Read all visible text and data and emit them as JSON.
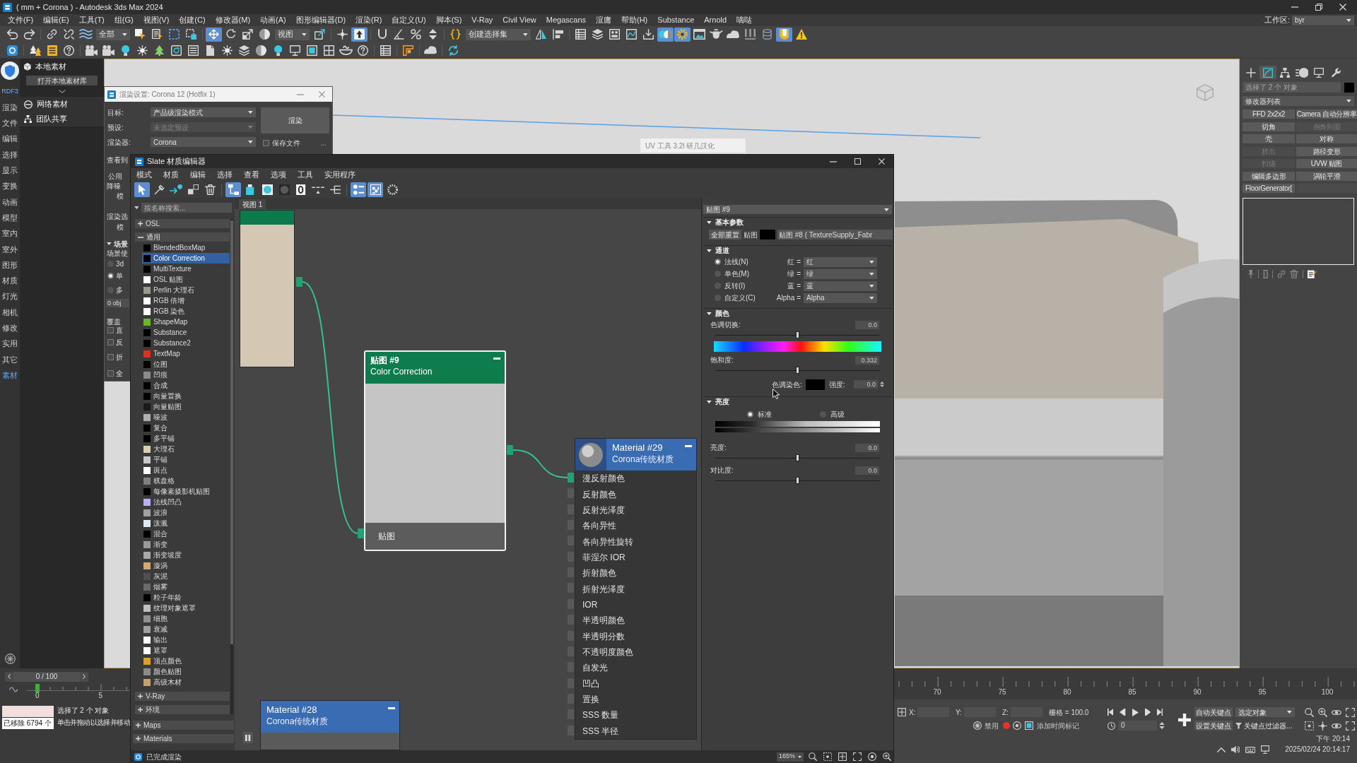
{
  "window": {
    "title": "( mm + Corona ) - Autodesk 3ds Max 2024"
  },
  "menu_bar": {
    "items": [
      "文件(F)",
      "编辑(E)",
      "工具(T)",
      "组(G)",
      "视图(V)",
      "创建(C)",
      "修改器(M)",
      "动画(A)",
      "图形编辑器(D)",
      "渲染(R)",
      "自定义(U)",
      "脚本(S)",
      "V-Ray",
      "Civil View",
      "Megascans",
      "渲庸",
      "帮助(H)",
      "Substance",
      "Arnold",
      "嘀哒"
    ],
    "workspace_label": "工作区:",
    "workspace_value": "byr"
  },
  "main_toolbar": [
    {
      "kind": "button",
      "selected": false
    },
    {
      "kind": "button",
      "selected": false
    },
    {
      "kind": "separator"
    },
    {
      "kind": "button",
      "selected": false
    },
    {
      "kind": "button",
      "selected": false
    },
    {
      "kind": "button",
      "selected": false
    },
    {
      "kind": "dropdown",
      "value": "全部"
    },
    {
      "kind": "button",
      "selected": false
    },
    {
      "kind": "button",
      "selected": false
    },
    {
      "kind": "button",
      "selected": false
    },
    {
      "kind": "button",
      "selected": false
    },
    {
      "kind": "separator"
    },
    {
      "kind": "button",
      "selected": true
    },
    {
      "kind": "button",
      "selected": false
    },
    {
      "kind": "button",
      "selected": false
    },
    {
      "kind": "button",
      "selected": false
    },
    {
      "kind": "dropdown",
      "value": "视图"
    },
    {
      "kind": "button",
      "selected": false
    },
    {
      "kind": "separator"
    },
    {
      "kind": "button",
      "selected": false
    },
    {
      "kind": "button",
      "selected": true
    },
    {
      "kind": "separator"
    },
    {
      "kind": "button",
      "selected": false
    },
    {
      "kind": "button",
      "selected": false
    },
    {
      "kind": "button",
      "selected": false
    },
    {
      "kind": "button",
      "selected": false
    },
    {
      "kind": "separator"
    },
    {
      "kind": "button",
      "selected": false
    },
    {
      "kind": "dropdown",
      "value": "创建选择集"
    },
    {
      "kind": "button",
      "selected": false
    },
    {
      "kind": "button",
      "selected": false
    },
    {
      "kind": "separator"
    },
    {
      "kind": "button",
      "selected": false
    },
    {
      "kind": "button",
      "selected": false
    },
    {
      "kind": "button",
      "selected": false
    },
    {
      "kind": "button",
      "selected": false
    },
    {
      "kind": "button",
      "selected": false
    },
    {
      "kind": "button",
      "selected": true
    },
    {
      "kind": "button",
      "selected": true
    },
    {
      "kind": "button",
      "selected": false
    },
    {
      "kind": "button",
      "selected": false
    },
    {
      "kind": "button",
      "selected": false
    },
    {
      "kind": "button",
      "selected": false
    },
    {
      "kind": "button",
      "selected": false
    },
    {
      "kind": "button",
      "selected": true
    },
    {
      "kind": "button",
      "selected": false
    }
  ],
  "secondary_toolbar": [
    {
      "kind": "button",
      "selected": false
    },
    {
      "kind": "separator"
    },
    {
      "kind": "button",
      "selected": false
    },
    {
      "kind": "button",
      "selected": false
    },
    {
      "kind": "button",
      "selected": false
    },
    {
      "kind": "separator"
    },
    {
      "kind": "button",
      "selected": false
    },
    {
      "kind": "button",
      "selected": false
    },
    {
      "kind": "button",
      "selected": false
    },
    {
      "kind": "button",
      "selected": false
    },
    {
      "kind": "button",
      "selected": false
    },
    {
      "kind": "button",
      "selected": false
    },
    {
      "kind": "button",
      "selected": false
    },
    {
      "kind": "button",
      "selected": false
    },
    {
      "kind": "button",
      "selected": false
    },
    {
      "kind": "button",
      "selected": false
    },
    {
      "kind": "button",
      "selected": false
    },
    {
      "kind": "button",
      "selected": false
    },
    {
      "kind": "button",
      "selected": false
    },
    {
      "kind": "button",
      "selected": false
    },
    {
      "kind": "button",
      "selected": false
    },
    {
      "kind": "button",
      "selected": false
    },
    {
      "kind": "button",
      "selected": false
    },
    {
      "kind": "separator"
    },
    {
      "kind": "button",
      "selected": false
    },
    {
      "kind": "separator"
    },
    {
      "kind": "button",
      "selected": false
    },
    {
      "kind": "separator"
    },
    {
      "kind": "button",
      "selected": false
    },
    {
      "kind": "separator"
    },
    {
      "kind": "button",
      "selected": false
    }
  ],
  "side_tabs": {
    "label": "RDF3",
    "items": [
      {
        "label": "渲染",
        "selected": false
      },
      {
        "label": "文件",
        "selected": false
      },
      {
        "label": "编辑",
        "selected": false
      },
      {
        "label": "选择",
        "selected": false
      },
      {
        "label": "显示",
        "selected": false
      },
      {
        "label": "变换",
        "selected": false
      },
      {
        "label": "动画",
        "selected": false
      },
      {
        "label": "模型",
        "selected": false
      },
      {
        "label": "室内",
        "selected": false
      },
      {
        "label": "室外",
        "selected": false
      },
      {
        "label": "图形",
        "selected": false
      },
      {
        "label": "材质",
        "selected": false
      },
      {
        "label": "灯光",
        "selected": false
      },
      {
        "label": "相机",
        "selected": false
      },
      {
        "label": "修改",
        "selected": false
      },
      {
        "label": "实用",
        "selected": false
      },
      {
        "label": "其它",
        "selected": false
      },
      {
        "label": "素材",
        "selected": true
      }
    ]
  },
  "asset_panel": {
    "local_title": "本地素材",
    "open_button": "打开本地素材库",
    "online_title": "网络素材",
    "team_title": "团队共享"
  },
  "viewport": {
    "tool_window_title": "UV 工具 3.2l 研几汉化"
  },
  "command_panel": {
    "tabs": [
      {
        "selected": false
      },
      {
        "selected": true
      },
      {
        "selected": false
      },
      {
        "selected": false
      },
      {
        "selected": false
      },
      {
        "selected": false
      }
    ],
    "object_name": "选择了 2 个 对象",
    "modifier_list": "修改器列表",
    "modifier_buttons": [
      {
        "kind": "button",
        "label": "FFD 2x2x2",
        "disabled": false
      },
      {
        "kind": "button",
        "label": "Camera 自动分辨率",
        "disabled": false
      },
      {
        "kind": "button",
        "label": "切角",
        "disabled": false
      },
      {
        "kind": "button",
        "label": "倒角剖面",
        "disabled": true
      },
      {
        "kind": "button",
        "label": "壳",
        "disabled": false
      },
      {
        "kind": "button",
        "label": "对称",
        "disabled": false
      },
      {
        "kind": "button",
        "label": "挤出",
        "disabled": true
      },
      {
        "kind": "button",
        "label": "路径变形",
        "disabled": false
      },
      {
        "kind": "button",
        "label": "扫描",
        "disabled": true
      },
      {
        "kind": "button",
        "label": "UVW 贴图",
        "disabled": false
      },
      {
        "kind": "button",
        "label": "编辑多边形",
        "disabled": false
      },
      {
        "kind": "button",
        "label": "涡轮平滑",
        "disabled": false
      },
      {
        "kind": "button",
        "label": "FloorGenerator[",
        "disabled": false
      },
      {
        "kind": "blank"
      }
    ]
  },
  "render_setup": {
    "title": "渲染设置: Corona 12 (Hotfix 1)",
    "fields": [
      {
        "label": "目标:",
        "value": "产品级渲染模式",
        "disabled": false
      },
      {
        "label": "预设:",
        "value": "未选定预设",
        "disabled": true
      },
      {
        "label": "渲染器:",
        "value": "Corona",
        "disabled": false
      }
    ],
    "render_button": "渲染",
    "save_file": {
      "label": "保存文件",
      "checked": false
    },
    "more_button": "...",
    "clipped_rows": [
      {
        "kind": "label",
        "text": "查看到"
      },
      {
        "kind": "tab",
        "text": "公用"
      },
      {
        "kind": "label",
        "text": "降噪"
      },
      {
        "kind": "indent",
        "text": "模"
      },
      {
        "kind": "label",
        "text": "渲染选"
      },
      {
        "kind": "indent",
        "text": "模"
      },
      {
        "kind": "section",
        "text": "场景"
      },
      {
        "kind": "label",
        "text": "场景使"
      },
      {
        "kind": "radio",
        "text": "3d",
        "selected": false
      },
      {
        "kind": "radio",
        "text": "单",
        "selected": true
      },
      {
        "kind": "radio",
        "text": "多",
        "selected": false
      },
      {
        "kind": "field",
        "text": "0 obj"
      },
      {
        "kind": "label",
        "text": "覆盖"
      },
      {
        "kind": "checkbox",
        "text": "直",
        "checked": false
      },
      {
        "kind": "checkbox",
        "text": "反",
        "checked": false
      },
      {
        "kind": "checkbox",
        "text": "折",
        "checked": false
      },
      {
        "kind": "checkbox",
        "text": "全",
        "checked": false
      }
    ]
  },
  "slate_editor": {
    "title": "Slate 材质编辑器",
    "menu": [
      "模式",
      "材质",
      "编辑",
      "选择",
      "查看",
      "选项",
      "工具",
      "实用程序"
    ],
    "toolbar": [
      {
        "selected": true
      },
      {
        "selected": false
      },
      {
        "selected": false
      },
      {
        "selected": false
      },
      {
        "selected": false
      },
      {
        "selected": true
      },
      {
        "selected": false
      },
      {
        "selected": false
      },
      {
        "selected": false
      },
      {
        "selected": false
      },
      {
        "selected": false
      },
      {
        "selected": false
      },
      {
        "selected": true
      },
      {
        "selected": true
      },
      {
        "selected": false
      }
    ],
    "browser": {
      "search_placeholder": "按名称搜索...",
      "groups": [
        {
          "label": "OSL",
          "expanded": false
        },
        {
          "label": "通用",
          "expanded": true,
          "items": [
            {
              "label": "BlendedBoxMap",
              "color": "#000000",
              "selected": false
            },
            {
              "label": "Color Correction",
              "color": "#000000",
              "selected": true
            },
            {
              "label": "MultiTexture",
              "color": "#000000",
              "selected": false
            },
            {
              "label": "OSL 贴图",
              "color": "#ffffff",
              "selected": false
            },
            {
              "label": "Perlin 大理石",
              "color": "#9a9a8a",
              "selected": false
            },
            {
              "label": "RGB 倍增",
              "color": "#ffffff",
              "selected": false
            },
            {
              "label": "RGB 染色",
              "color": "#ffffff",
              "selected": false
            },
            {
              "label": "ShapeMap",
              "color": "#6ab82a",
              "selected": false
            },
            {
              "label": "Substance",
              "color": "#000000",
              "selected": false
            },
            {
              "label": "Substance2",
              "color": "#000000",
              "selected": false
            },
            {
              "label": "TextMap",
              "color": "#e03020",
              "selected": false
            },
            {
              "label": "位图",
              "color": "#000000",
              "selected": false
            },
            {
              "label": "凹痕",
              "color": "#8a8a8a",
              "selected": false
            },
            {
              "label": "合成",
              "color": "#000000",
              "selected": false
            },
            {
              "label": "向量置换",
              "color": "#000000",
              "selected": false
            },
            {
              "label": "向量贴图",
              "color": "#1a1a1a",
              "selected": false
            },
            {
              "label": "噪波",
              "color": "#b0b0b0",
              "selected": false
            },
            {
              "label": "复合",
              "color": "#000000",
              "selected": false
            },
            {
              "label": "多平铺",
              "color": "#000000",
              "selected": false
            },
            {
              "label": "大理石",
              "color": "#d8d0b0",
              "selected": false
            },
            {
              "label": "平铺",
              "color": "#c8c8c8",
              "selected": false
            },
            {
              "label": "斑点",
              "color": "#ffffff",
              "selected": false
            },
            {
              "label": "棋盘格",
              "color": "#808080",
              "selected": false
            },
            {
              "label": "每像素摄影机贴图",
              "color": "#000000",
              "selected": false
            },
            {
              "label": "法线凹凸",
              "color": "#b8b0f0",
              "selected": false
            },
            {
              "label": "波浪",
              "color": "#a0a0a0",
              "selected": false
            },
            {
              "label": "泼溅",
              "color": "#e0e8f0",
              "selected": false
            },
            {
              "label": "混合",
              "color": "#000000",
              "selected": false
            },
            {
              "label": "渐变",
              "color": "#9a9a9a",
              "selected": false
            },
            {
              "label": "渐变坡度",
              "color": "#a8a8a8",
              "selected": false
            },
            {
              "label": "漩涡",
              "color": "#d8a870",
              "selected": false
            },
            {
              "label": "灰泥",
              "color": "#505050",
              "selected": false
            },
            {
              "label": "烟雾",
              "color": "#6a6a6a",
              "selected": false
            },
            {
              "label": "粒子年龄",
              "color": "#000000",
              "selected": false
            },
            {
              "label": "纹理对象遮罩",
              "color": "#c0c0c0",
              "selected": false
            },
            {
              "label": "细胞",
              "color": "#909090",
              "selected": false
            },
            {
              "label": "衰减",
              "color": "#a0a0a0",
              "selected": false
            },
            {
              "label": "输出",
              "color": "#ffffff",
              "selected": false
            },
            {
              "label": "遮罩",
              "color": "#ffffff",
              "selected": false
            },
            {
              "label": "顶点颜色",
              "color": "#e0a020",
              "selected": false
            },
            {
              "label": "颜色贴图",
              "color": "#8a8a8a",
              "selected": false
            },
            {
              "label": "高级木材",
              "color": "#c8a070",
              "selected": false
            }
          ]
        },
        {
          "label": "V-Ray",
          "expanded": false
        },
        {
          "label": "环境",
          "expanded": false
        }
      ],
      "sections": [
        {
          "label": "Maps",
          "expanded": false
        },
        {
          "label": "Materials",
          "expanded": false
        }
      ]
    },
    "view_tab": {
      "label": "视图 1",
      "selected": true
    },
    "nodes": [
      {
        "kind": "texture",
        "selected": false
      },
      {
        "kind": "map",
        "title": "贴图 #9",
        "subtitle": "Color Correction",
        "selected": true,
        "slots": [
          "贴图"
        ]
      },
      {
        "kind": "material",
        "title": "Material #29",
        "subtitle": "Corona传统材质",
        "selected": false,
        "preview": true,
        "slots": [
          "漫反射颜色",
          "反射颜色",
          "反射光泽度",
          "各向异性",
          "各向异性旋转",
          "菲涅尔 IOR",
          "折射颜色",
          "折射光泽度",
          "IOR",
          "半透明颜色",
          "半透明分数",
          "不透明度颜色",
          "自发光",
          "凹凸",
          "置换",
          "SSS 数量",
          "SSS 半径"
        ]
      },
      {
        "kind": "material",
        "title": "Material #28",
        "subtitle": "Corona传统材质",
        "selected": false,
        "preview": false
      }
    ],
    "parameters": {
      "header": "贴图 #9",
      "rollouts": [
        {
          "kind": "basic",
          "title": "基本参数",
          "reset_button": "全部重置",
          "map_label": "贴图",
          "map_value": "贴图 #8 ( TextureSupply_Fabr"
        },
        {
          "kind": "channels",
          "title": "通道",
          "options": [
            {
              "label": "法线(N)",
              "selected": true
            },
            {
              "label": "单色(M)",
              "selected": false
            },
            {
              "label": "反转(I)",
              "selected": false
            },
            {
              "label": "自定义(C)",
              "selected": false
            }
          ],
          "mappings": [
            {
              "label": "红 =",
              "value": "红"
            },
            {
              "label": "绿 =",
              "value": "绿"
            },
            {
              "label": "蓝 =",
              "value": "蓝"
            },
            {
              "label": "Alpha =",
              "value": "Alpha"
            }
          ]
        },
        {
          "kind": "color",
          "title": "颜色",
          "hue_shift": {
            "label": "色调切换:",
            "value": "0.0",
            "level": 0.5
          },
          "saturation": {
            "label": "饱和度:",
            "value": "0.332",
            "level": 0.5
          },
          "tint_label": "色调染色:",
          "strength": {
            "label": "强度:",
            "value": "0.0"
          }
        },
        {
          "kind": "brightness",
          "title": "亮度",
          "modes": [
            {
              "label": "标准",
              "selected": true
            },
            {
              "label": "高级",
              "selected": false
            }
          ],
          "brightness": {
            "label": "亮度:",
            "value": "0.0",
            "level": 0.5
          },
          "contrast": {
            "label": "对比度:",
            "value": "0.0",
            "level": 0.5
          }
        }
      ]
    },
    "status": "已完成渲染",
    "zoom": "165%"
  },
  "timeline": {
    "frame": "0 / 100",
    "left_ticks": [
      "0",
      "5"
    ],
    "right_ticks": [
      "70",
      "75",
      "80",
      "85",
      "90",
      "95",
      "100"
    ]
  },
  "status_bar": {
    "listener_output": "已移除 6794 个",
    "selection": "选择了 2 个 对象",
    "prompt": "单击并拖动以选择并移动",
    "axes": [
      "X:",
      "Y:",
      "Z:"
    ],
    "grid": "栅格 = 100.0",
    "disable": "禁用",
    "add_time_tag": "添加时间标记",
    "current_frame": "0",
    "auto_key": "自动关键点",
    "key_mode": "选定对象",
    "set_key": "设置关键点",
    "key_filters": "关键点过滤器..."
  },
  "taskbar": {
    "time": "下午 20:14",
    "timestamp": "2025/02/24 20:14:17"
  }
}
